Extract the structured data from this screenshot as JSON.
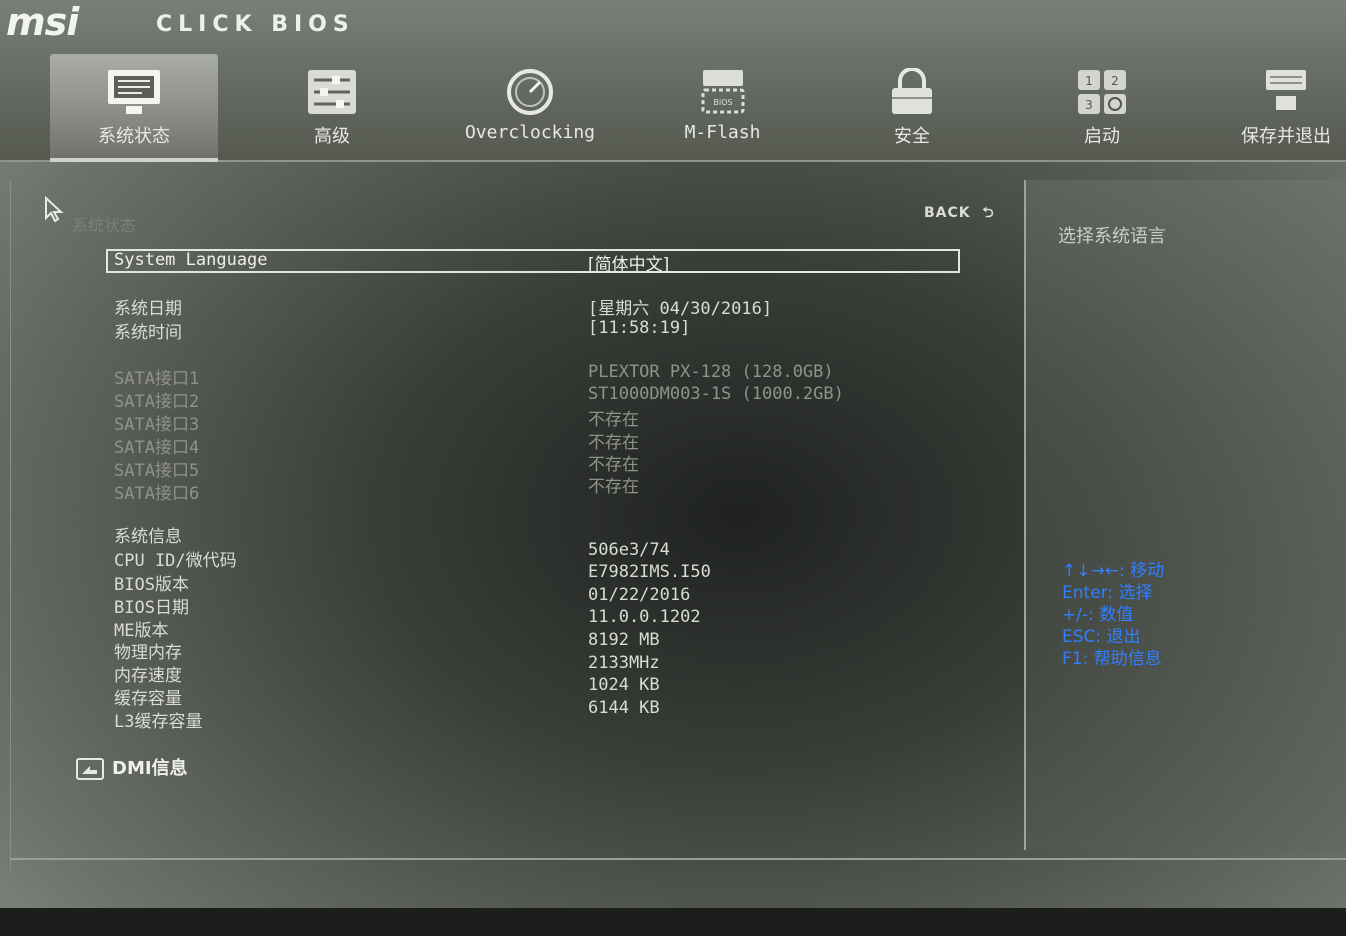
{
  "header": {
    "logo": "msi",
    "product": "CLICK BIOS"
  },
  "tabs": [
    {
      "label": "系统状态",
      "icon": "monitor-icon",
      "active": true
    },
    {
      "label": "高级",
      "icon": "settings-icon",
      "active": false
    },
    {
      "label": "Overclocking",
      "icon": "gauge-icon",
      "active": false
    },
    {
      "label": "M-Flash",
      "icon": "bios-chip-icon",
      "active": false
    },
    {
      "label": "安全",
      "icon": "lock-icon",
      "active": false
    },
    {
      "label": "启动",
      "icon": "boot-order-icon",
      "active": false
    },
    {
      "label": "保存并退出",
      "icon": "save-exit-icon",
      "active": false
    }
  ],
  "breadcrumb": "系统状态",
  "back_label": "BACK",
  "system_language": {
    "label": "System Language",
    "value": "[简体中文]"
  },
  "date_time": {
    "date_label": "系统日期",
    "date_value": "[星期六  04/30/2016]",
    "time_label": "系统时间",
    "time_value": "[11:58:19]"
  },
  "sata": [
    {
      "label": "SATA接口1",
      "value": "PLEXTOR PX-128  (128.0GB)"
    },
    {
      "label": "SATA接口2",
      "value": "ST1000DM003-1S  (1000.2GB)"
    },
    {
      "label": "SATA接口3",
      "value": "不存在"
    },
    {
      "label": "SATA接口4",
      "value": "不存在"
    },
    {
      "label": "SATA接口5",
      "value": "不存在"
    },
    {
      "label": "SATA接口6",
      "value": "不存在"
    }
  ],
  "system_info": {
    "heading": "系统信息",
    "rows": [
      {
        "label": "CPU  ID/微代码",
        "value": "506e3/74"
      },
      {
        "label": "BIOS版本",
        "value": "E7982IMS.I50"
      },
      {
        "label": "BIOS日期",
        "value": "01/22/2016"
      },
      {
        "label": "ME版本",
        "value": "11.0.0.1202"
      },
      {
        "label": "物理内存",
        "value": "8192  MB"
      },
      {
        "label": "内存速度",
        "value": "2133MHz"
      },
      {
        "label": "缓存容量",
        "value": "1024  KB"
      },
      {
        "label": "L3缓存容量",
        "value": "6144  KB"
      }
    ]
  },
  "dmi_label": "DMI信息",
  "help": {
    "title": "选择系统语言",
    "keys": [
      "↑↓→←: 移动",
      "Enter: 选择",
      "+/-: 数值",
      "ESC: 退出",
      "F1: 帮助信息"
    ]
  },
  "colors": {
    "help_key": "#2f7fff",
    "active_tab": "#9a9e96"
  }
}
